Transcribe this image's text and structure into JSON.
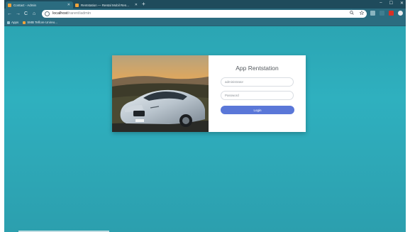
{
  "browser": {
    "tabs": [
      {
        "title": "Contact - Admin"
      },
      {
        "title": "Rentstation — Rental Mobil Ren..."
      }
    ],
    "new_tab": "+",
    "window_controls": [
      "–",
      "☐",
      "✕"
    ],
    "nav": {
      "back": "←",
      "forward": "→",
      "reload": "C",
      "home": "⌂"
    },
    "address": {
      "host": "localhost",
      "path": "/rarent/admin"
    },
    "omnibox_icons": [
      "search-icon",
      "star-icon"
    ],
    "bookmarks": [
      {
        "label": "Apps"
      },
      {
        "label": "SMB Teflore Unireo..."
      }
    ]
  },
  "login": {
    "title": "App Rentstation",
    "username_placeholder": "administrator",
    "password_placeholder": "Password",
    "button_label": "Login"
  },
  "colors": {
    "background": "#2fb0bf",
    "button": "#5a77d8",
    "chrome": "#2b6c80"
  }
}
